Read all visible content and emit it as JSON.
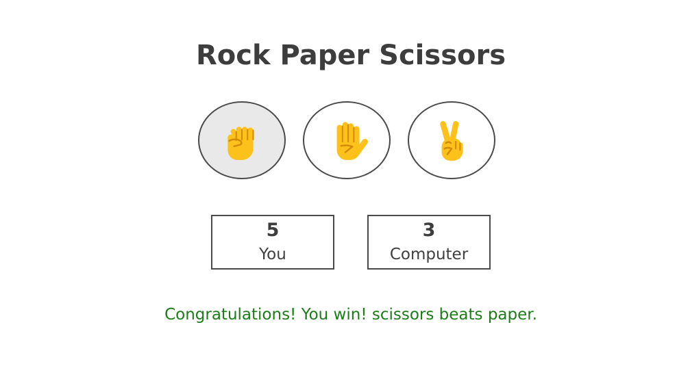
{
  "title": "Rock Paper Scissors",
  "choices": [
    {
      "id": "rock",
      "icon": "raised-fist-icon",
      "selected": true
    },
    {
      "id": "paper",
      "icon": "raised-hand-icon",
      "selected": false
    },
    {
      "id": "scissors",
      "icon": "victory-hand-icon",
      "selected": false
    }
  ],
  "scores": {
    "user": {
      "value": "5",
      "label": "You"
    },
    "computer": {
      "value": "3",
      "label": "Computer"
    }
  },
  "result": {
    "message": "Congratulations! You win! scissors beats paper.",
    "color": "#1c7d18"
  },
  "colors": {
    "emoji_fill": "#fcc21b",
    "emoji_detail": "#d48a0c",
    "selected_bg": "#e9e9e9"
  }
}
